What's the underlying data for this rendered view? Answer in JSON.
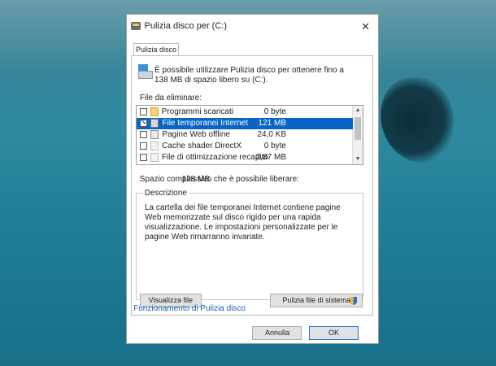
{
  "window": {
    "title": "Pulizia disco per  (C:)"
  },
  "tabs": [
    {
      "label": "Pulizia disco"
    }
  ],
  "intro": {
    "text": "È possibile utilizzare Pulizia disco per ottenere fino a 138 MB di spazio libero su (C:)."
  },
  "files": {
    "label": "File da eliminare:",
    "items": [
      {
        "name": "Programmi scaricati",
        "size": "0 byte",
        "checked": false,
        "icon": "folder-icon"
      },
      {
        "name": "File temporanei Internet",
        "size": "121 MB",
        "checked": true,
        "selected": true,
        "icon": "lock-icon"
      },
      {
        "name": "Pagine Web offline",
        "size": "24,0 KB",
        "checked": false,
        "icon": "web-page-icon"
      },
      {
        "name": "Cache shader DirectX",
        "size": "0 byte",
        "checked": false,
        "icon": "blank-file-icon"
      },
      {
        "name": "File di ottimizzazione recapito",
        "size": "2,87 MB",
        "checked": false,
        "icon": "blank-file-icon"
      }
    ]
  },
  "total": {
    "label": "Spazio complessivo che è possibile liberare:",
    "value": "128 MB"
  },
  "description": {
    "legend": "Descrizione",
    "text": "La cartella dei file temporanei Internet contiene pagine Web memorizzate sul disco rigido per una rapida visualizzazione. Le impostazioni personalizzate per le pagine Web rimarranno invariate."
  },
  "buttons": {
    "system_files": "Pulizia file di sistema",
    "view_files": "Visualizza file",
    "ok": "OK",
    "cancel": "Annulla"
  },
  "links": {
    "how_it_works": "Funzionamento di Pulizia disco"
  },
  "colors": {
    "selection": "#0a64c8",
    "link": "#1a5fb4",
    "ok_border": "#1e74d8"
  }
}
